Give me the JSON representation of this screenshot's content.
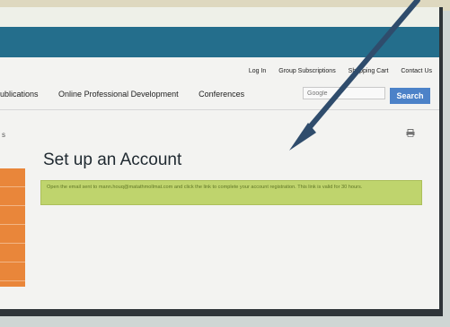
{
  "nav": {
    "utility": [
      "Log In",
      "Group Subscriptions",
      "Shopping Cart",
      "Contact Us"
    ],
    "main": [
      "ublications",
      "Online Professional Development",
      "Conferences"
    ]
  },
  "search": {
    "placeholder": "Google",
    "button_label": "Search"
  },
  "breadcrumb": {
    "fragment": "s"
  },
  "page": {
    "title": "Set up an Account"
  },
  "alert": {
    "message": "Open the email sent to mann.houq@matathmollmat.com and click the link to complete your account registration. This link is valid for 30 hours.",
    "color": "#bfd46d"
  },
  "theme": {
    "banner_color": "#246e8c",
    "sidebar_color": "#e9863a",
    "arrow_color": "#2f4c6c",
    "search_button_color": "#4c82c8"
  },
  "icons": {
    "print": "printer-icon",
    "arrow": "arrow-pointer-icon"
  }
}
